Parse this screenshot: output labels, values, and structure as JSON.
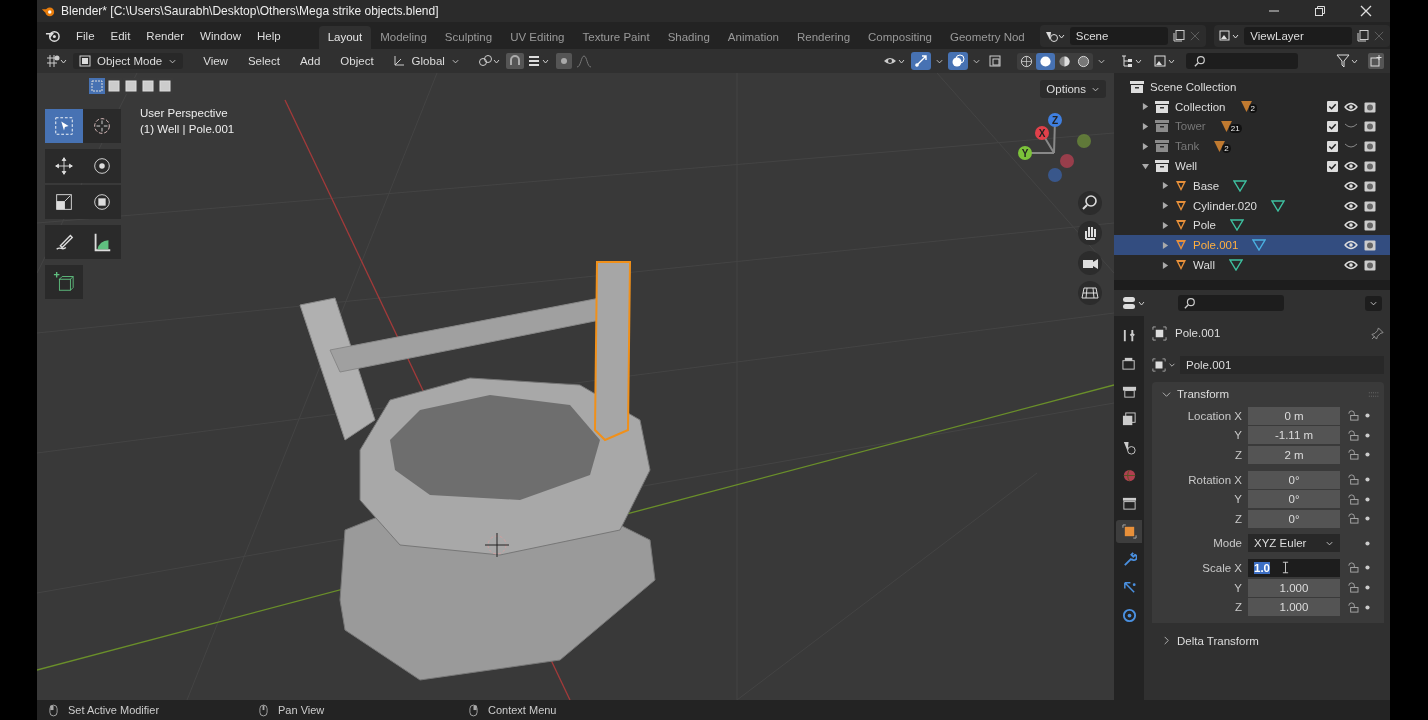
{
  "window": {
    "title": "Blender* [C:\\Users\\Saurabh\\Desktop\\Others\\Mega strike objects.blend]"
  },
  "menus": [
    "File",
    "Edit",
    "Render",
    "Window",
    "Help"
  ],
  "workspaces": [
    {
      "label": "Layout",
      "selected": true
    },
    {
      "label": "Modeling",
      "selected": false
    },
    {
      "label": "Sculpting",
      "selected": false
    },
    {
      "label": "UV Editing",
      "selected": false
    },
    {
      "label": "Texture Paint",
      "selected": false
    },
    {
      "label": "Shading",
      "selected": false
    },
    {
      "label": "Animation",
      "selected": false
    },
    {
      "label": "Rendering",
      "selected": false
    },
    {
      "label": "Compositing",
      "selected": false
    },
    {
      "label": "Geometry Nod",
      "selected": false
    }
  ],
  "scene": {
    "value": "Scene"
  },
  "view_layer": {
    "value": "ViewLayer"
  },
  "viewport": {
    "mode": "Object Mode",
    "menus": [
      "View",
      "Select",
      "Add",
      "Object"
    ],
    "orientation": "Global",
    "select_modes": [
      {
        "selected": true
      },
      {
        "selected": false
      },
      {
        "selected": false
      },
      {
        "selected": false
      },
      {
        "selected": false
      }
    ],
    "toggles": [
      {
        "kind": "gizmo",
        "on": true
      },
      {
        "kind": "overlay",
        "on": true
      },
      {
        "kind": "xray",
        "on": false
      }
    ],
    "shading": [
      {
        "kind": "wireframe",
        "selected": false
      },
      {
        "kind": "solid",
        "selected": true
      },
      {
        "kind": "material",
        "selected": false
      },
      {
        "kind": "rendered",
        "selected": false
      }
    ],
    "options": "Options",
    "perspective": "User Perspective",
    "object_info": "(1) Well | Pole.001",
    "tools": [
      {
        "kind": "select",
        "selected": true
      },
      {
        "kind": "cursor",
        "selected": false
      },
      {
        "kind": "move",
        "selected": false
      },
      {
        "kind": "rotate",
        "selected": false
      },
      {
        "kind": "scale",
        "selected": false
      },
      {
        "kind": "transform",
        "selected": false
      },
      {
        "kind": "annotate",
        "selected": false
      },
      {
        "kind": "measure",
        "selected": false
      },
      {
        "kind": "add",
        "selected": false
      }
    ],
    "axes": [
      {
        "label": "X",
        "color": "#e0404a"
      },
      {
        "label": "Y",
        "color": "#7cc23a"
      },
      {
        "label": "Z",
        "color": "#3f7fe0"
      }
    ]
  },
  "outliner": {
    "root": "Scene Collection",
    "items": [
      {
        "kind": "collection",
        "name": "Collection",
        "count": "2",
        "checked": true,
        "visible": true,
        "expanded": false,
        "selected": false
      },
      {
        "kind": "collection",
        "name": "Tower",
        "count": "21",
        "checked": true,
        "visible": false,
        "expanded": false,
        "selected": false
      },
      {
        "kind": "collection",
        "name": "Tank",
        "count": "2",
        "checked": true,
        "visible": false,
        "expanded": false,
        "selected": false
      },
      {
        "kind": "collection",
        "name": "Well",
        "checked": true,
        "visible": true,
        "expanded": true,
        "selected": false,
        "children": [
          {
            "kind": "object",
            "name": "Base",
            "visible": true,
            "expanded": false,
            "selected": false
          },
          {
            "kind": "object",
            "name": "Cylinder.020",
            "visible": true,
            "expanded": false,
            "selected": false
          },
          {
            "kind": "object",
            "name": "Pole",
            "visible": true,
            "expanded": false,
            "selected": false
          },
          {
            "kind": "object",
            "name": "Pole.001",
            "visible": true,
            "expanded": false,
            "selected": true
          },
          {
            "kind": "object",
            "name": "Wall",
            "visible": true,
            "expanded": false,
            "selected": false
          }
        ]
      }
    ]
  },
  "properties": {
    "tabs": [
      {
        "kind": "tool",
        "selected": false
      },
      {
        "kind": "render",
        "selected": false
      },
      {
        "kind": "output",
        "selected": false
      },
      {
        "kind": "view_layer",
        "selected": false
      },
      {
        "kind": "scene",
        "selected": false
      },
      {
        "kind": "world",
        "selected": false
      },
      {
        "kind": "collection",
        "selected": false
      },
      {
        "kind": "object",
        "selected": true
      },
      {
        "kind": "modifier",
        "selected": false
      },
      {
        "kind": "particles",
        "selected": false
      },
      {
        "kind": "physics",
        "selected": false
      }
    ],
    "object_name": "Pole.001",
    "data_name": "Pole.001",
    "panels": [
      {
        "title": "Transform",
        "expanded": true,
        "rows": [
          {
            "kind": "field",
            "label": "Location X",
            "value": "0 m"
          },
          {
            "kind": "field",
            "label": "Y",
            "value": "-1.11 m"
          },
          {
            "kind": "field",
            "label": "Z",
            "value": "2 m"
          },
          {
            "kind": "field",
            "label": "Rotation X",
            "value": "0°"
          },
          {
            "kind": "field",
            "label": "Y",
            "value": "0°"
          },
          {
            "kind": "field",
            "label": "Z",
            "value": "0°"
          },
          {
            "kind": "dropdown",
            "label": "Mode",
            "value": "XYZ Euler"
          },
          {
            "kind": "editing",
            "label": "Scale X",
            "value": "1.0"
          },
          {
            "kind": "field",
            "label": "Y",
            "value": "1.000"
          },
          {
            "kind": "field",
            "label": "Z",
            "value": "1.000"
          }
        ]
      },
      {
        "title": "Delta Transform",
        "expanded": false
      }
    ]
  },
  "status_bar": [
    {
      "kind": "left",
      "text": "Set Active Modifier"
    },
    {
      "kind": "middle",
      "text": "Pan View"
    },
    {
      "kind": "right",
      "text": "Context Menu"
    }
  ]
}
